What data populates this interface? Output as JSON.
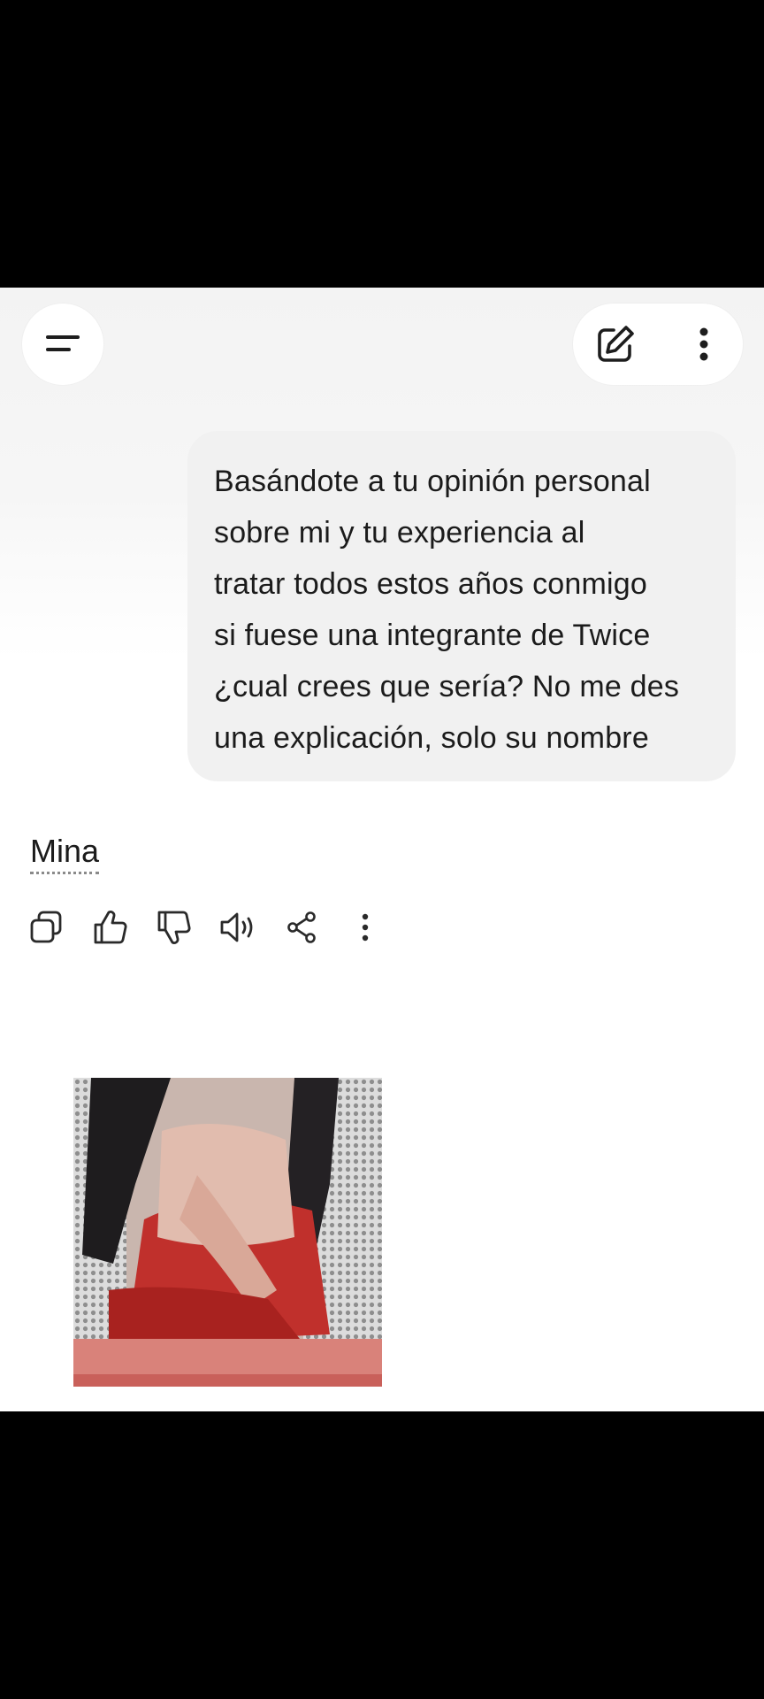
{
  "conversation": {
    "user_message": "Basándote a tu opinión personal\nsobre mi y tu experiencia al\ntratar todos estos años conmigo\nsi fuese una integrante de Twice\n¿cual crees que sería? No me des\nuna explicación, solo su nombre",
    "assistant_reply": "Mina"
  },
  "icons": {
    "menu": "menu-icon",
    "edit": "edit-icon",
    "more": "more-vertical-icon",
    "copy": "copy-icon",
    "like": "thumbs-up-icon",
    "dislike": "thumbs-down-icon",
    "read_aloud": "speaker-icon",
    "share": "share-icon",
    "reply_more": "more-vertical-icon"
  },
  "colors": {
    "bubble": "#f1f1f1",
    "text": "#1b1b1b",
    "icon": "#2a2a2a"
  }
}
